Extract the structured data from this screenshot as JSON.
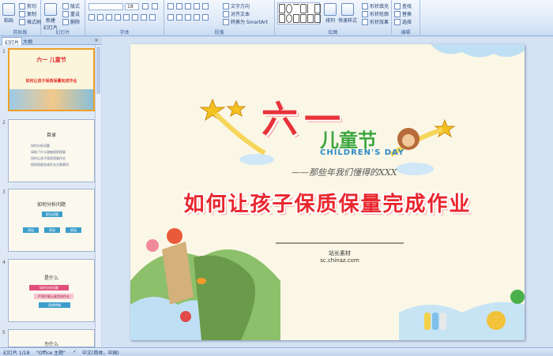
{
  "ribbon": {
    "clipboard": {
      "paste": "粘贴",
      "cut": "剪切",
      "copy": "复制",
      "format_painter": "格式刷",
      "label": "剪贴板"
    },
    "slides": {
      "new_slide": "新建\n幻灯片",
      "layout": "版式",
      "reset": "重设",
      "delete": "删除",
      "label": "幻灯片"
    },
    "font": {
      "size": "18",
      "label": "字体"
    },
    "paragraph": {
      "text_direction": "文字方向",
      "align_text": "对齐文本",
      "smartart": "转换为 SmartArt",
      "label": "段落"
    },
    "drawing": {
      "arrange": "排列",
      "quick_styles": "快速样式",
      "shape_fill": "形状填充",
      "shape_outline": "形状轮廓",
      "shape_effects": "形状效果",
      "label": "绘图"
    },
    "editing": {
      "find": "查找",
      "replace": "替换",
      "select": "选择",
      "label": "编辑"
    }
  },
  "left_pane": {
    "tab_slides": "幻灯片",
    "tab_outline": "大纲",
    "thumbs": [
      {
        "num": "1",
        "title": "六一 儿童节",
        "subtitle": "如何让孩子保质保量完成作业"
      },
      {
        "num": "2",
        "title": "目录",
        "lines": [
          "如何分析问题",
          "采取了什么措施保质保量",
          "如何让孩子保质保量作业",
          "保质保量完成作业注意事项"
        ]
      },
      {
        "num": "3",
        "title": "如何分析问题",
        "boxes": [
          "提出问题",
          "原因",
          "原因",
          "原因"
        ]
      },
      {
        "num": "4",
        "title": "是什么",
        "boxes": [
          "如何分析问题",
          "严肃仔细认真完成作业",
          "思想明确"
        ]
      },
      {
        "num": "5",
        "title": "为什么"
      }
    ]
  },
  "slide": {
    "title_big": "六一",
    "title_cn": "儿童节",
    "title_en": "CHILDREN'S DAY",
    "slogan": "——那些年我们懂得的XXX",
    "headline": "如何让孩子保质保量完成作业",
    "footer_line1": "站长素材",
    "footer_line2": "sc.chinaz.com"
  },
  "status_bar": {
    "slide_count": "幻灯片 1/18",
    "theme": "\"Office 主题\"",
    "language": "中文(简体，中国)"
  }
}
